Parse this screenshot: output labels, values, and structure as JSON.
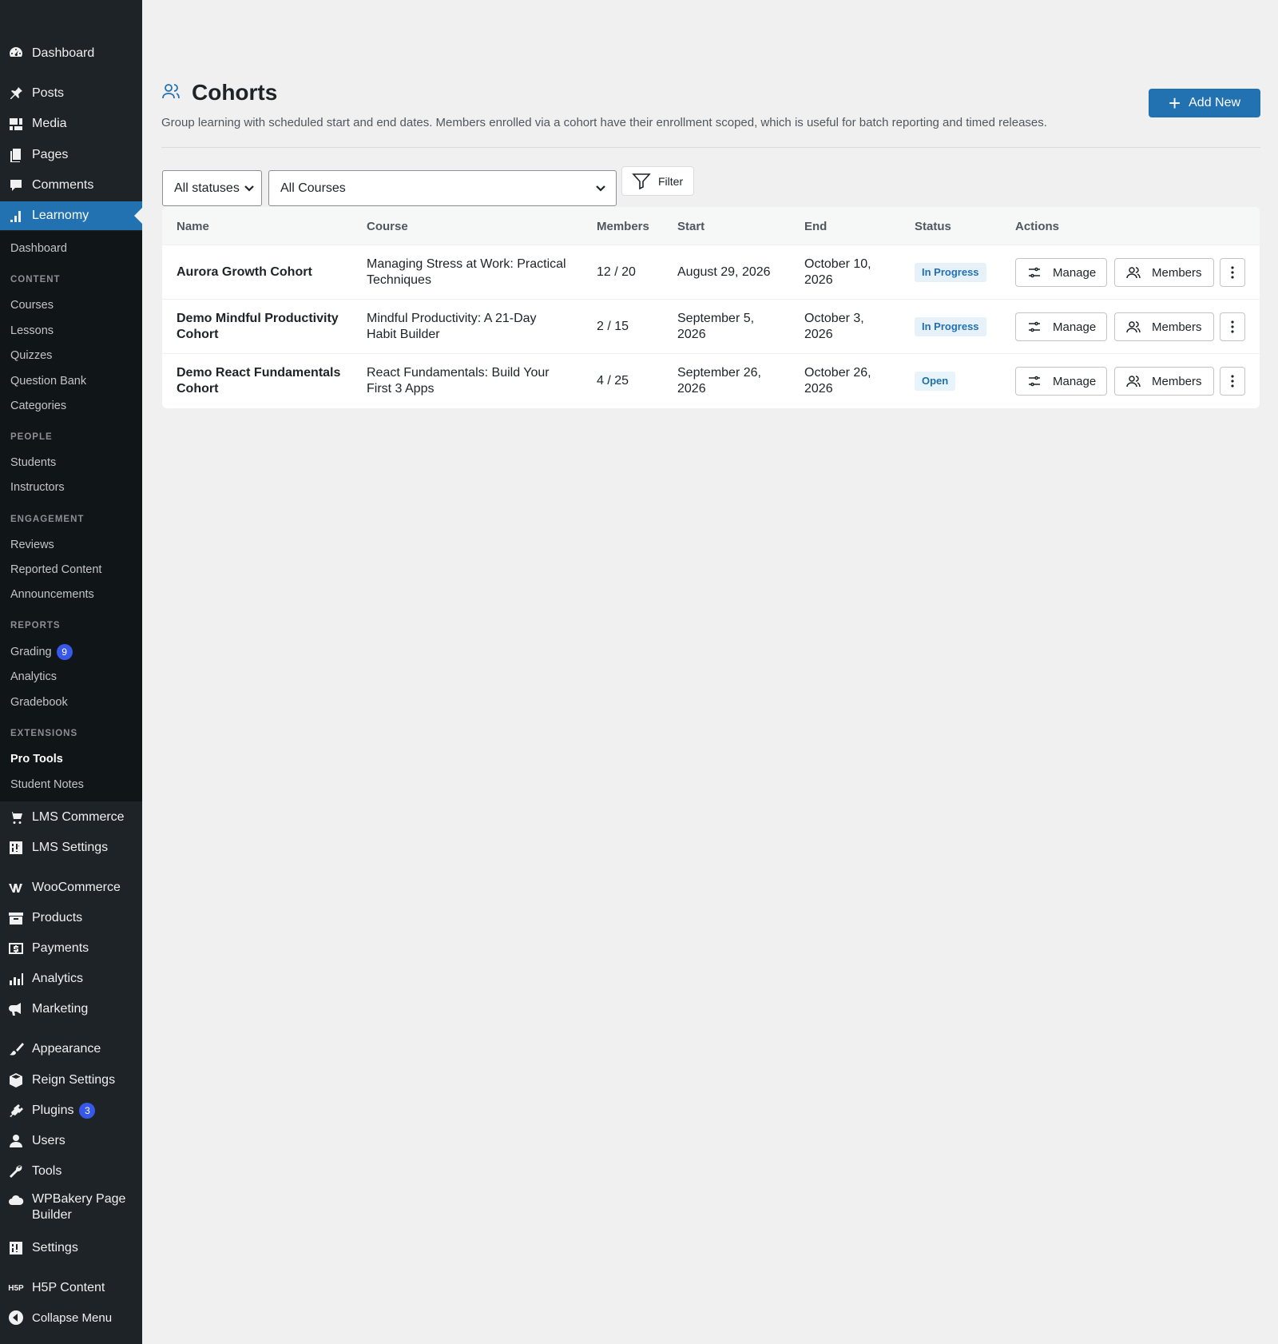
{
  "sidebar": {
    "items_top": [
      {
        "label": "Dashboard",
        "icon": "dashboard-icon"
      },
      {
        "label": "Posts",
        "icon": "pin-icon"
      },
      {
        "label": "Media",
        "icon": "media-icon"
      },
      {
        "label": "Pages",
        "icon": "pages-icon"
      },
      {
        "label": "Comments",
        "icon": "comments-icon"
      },
      {
        "label": "Learnomy",
        "icon": "bar-chart-icon"
      }
    ],
    "submenu": {
      "dashboard": "Dashboard",
      "content_heading": "Content",
      "courses": "Courses",
      "lessons": "Lessons",
      "quizzes": "Quizzes",
      "question_bank": "Question Bank",
      "categories": "Categories",
      "people_heading": "People",
      "students": "Students",
      "instructors": "Instructors",
      "engagement_heading": "Engagement",
      "reviews": "Reviews",
      "reported_content": "Reported Content",
      "announcements": "Announcements",
      "reports_heading": "Reports",
      "grading": "Grading",
      "grading_count": "9",
      "analytics": "Analytics",
      "gradebook": "Gradebook",
      "extensions_heading": "Extensions",
      "pro_tools": "Pro Tools",
      "student_notes": "Student Notes"
    },
    "items_bottom": [
      {
        "label": "LMS Commerce",
        "icon": "cart-icon"
      },
      {
        "label": "LMS Settings",
        "icon": "settings-grid-icon"
      },
      {
        "label": "WooCommerce",
        "icon": "woo-icon"
      },
      {
        "label": "Products",
        "icon": "archive-icon"
      },
      {
        "label": "Payments",
        "icon": "dollar-icon"
      },
      {
        "label": "Analytics",
        "icon": "bar-chart-icon"
      },
      {
        "label": "Marketing",
        "icon": "megaphone-icon"
      },
      {
        "label": "Appearance",
        "icon": "brush-icon"
      },
      {
        "label": "Reign Settings",
        "icon": "cube-icon"
      },
      {
        "label": "Plugins",
        "icon": "plug-icon",
        "count": "3"
      },
      {
        "label": "Users",
        "icon": "user-icon"
      },
      {
        "label": "Tools",
        "icon": "wrench-icon"
      },
      {
        "label": "WPBakery Page",
        "label2": "Builder",
        "icon": "cloud-icon"
      },
      {
        "label": "Settings",
        "icon": "settings-grid-icon"
      },
      {
        "label": "H5P Content",
        "icon": "h5p-icon"
      },
      {
        "label": "Collapse Menu",
        "icon": "collapse-icon"
      }
    ]
  },
  "page": {
    "title": "Cohorts",
    "description": "Group learning with scheduled start and end dates. Members enrolled via a cohort have their enrollment scoped, which is useful for batch reporting and timed releases.",
    "add_new": "Add New"
  },
  "filters": {
    "status_value": "All statuses",
    "course_value": "All Courses",
    "filter_label": "Filter"
  },
  "table": {
    "headers": [
      "Name",
      "Course",
      "Members",
      "Start",
      "End",
      "Status",
      "Actions"
    ],
    "rows": [
      {
        "name": [
          "Aurora Growth Cohort",
          ""
        ],
        "course": [
          "Managing Stress at Work: Practical",
          "Techniques"
        ],
        "members": "12 / 20",
        "start": [
          "August 29, 2026",
          ""
        ],
        "end": [
          "October 10,",
          "2026"
        ],
        "status": "In Progress",
        "manage": "Manage",
        "members_btn": "Members"
      },
      {
        "name": [
          "Demo Mindful Productivity",
          "Cohort"
        ],
        "course": [
          "Mindful Productivity: A 21-Day",
          "Habit Builder"
        ],
        "members": "2 / 15",
        "start": [
          "September 5,",
          "2026"
        ],
        "end": [
          "October 3,",
          "2026"
        ],
        "status": "In Progress",
        "manage": "Manage",
        "members_btn": "Members"
      },
      {
        "name": [
          "Demo React Fundamentals",
          "Cohort"
        ],
        "course": [
          "React Fundamentals: Build Your",
          "First 3 Apps"
        ],
        "members": "4 / 25",
        "start": [
          "September 26,",
          "2026"
        ],
        "end": [
          "October 26,",
          "2026"
        ],
        "status": "Open",
        "manage": "Manage",
        "members_btn": "Members"
      }
    ]
  },
  "colors": {
    "accent": "#2271b1",
    "sidebar_bg": "#1d2327",
    "in_progress_bg": "#e6f1fa",
    "in_progress_fg": "#2271b1",
    "open_bg": "#e8f4fb",
    "open_fg": "#1d6fa8"
  }
}
